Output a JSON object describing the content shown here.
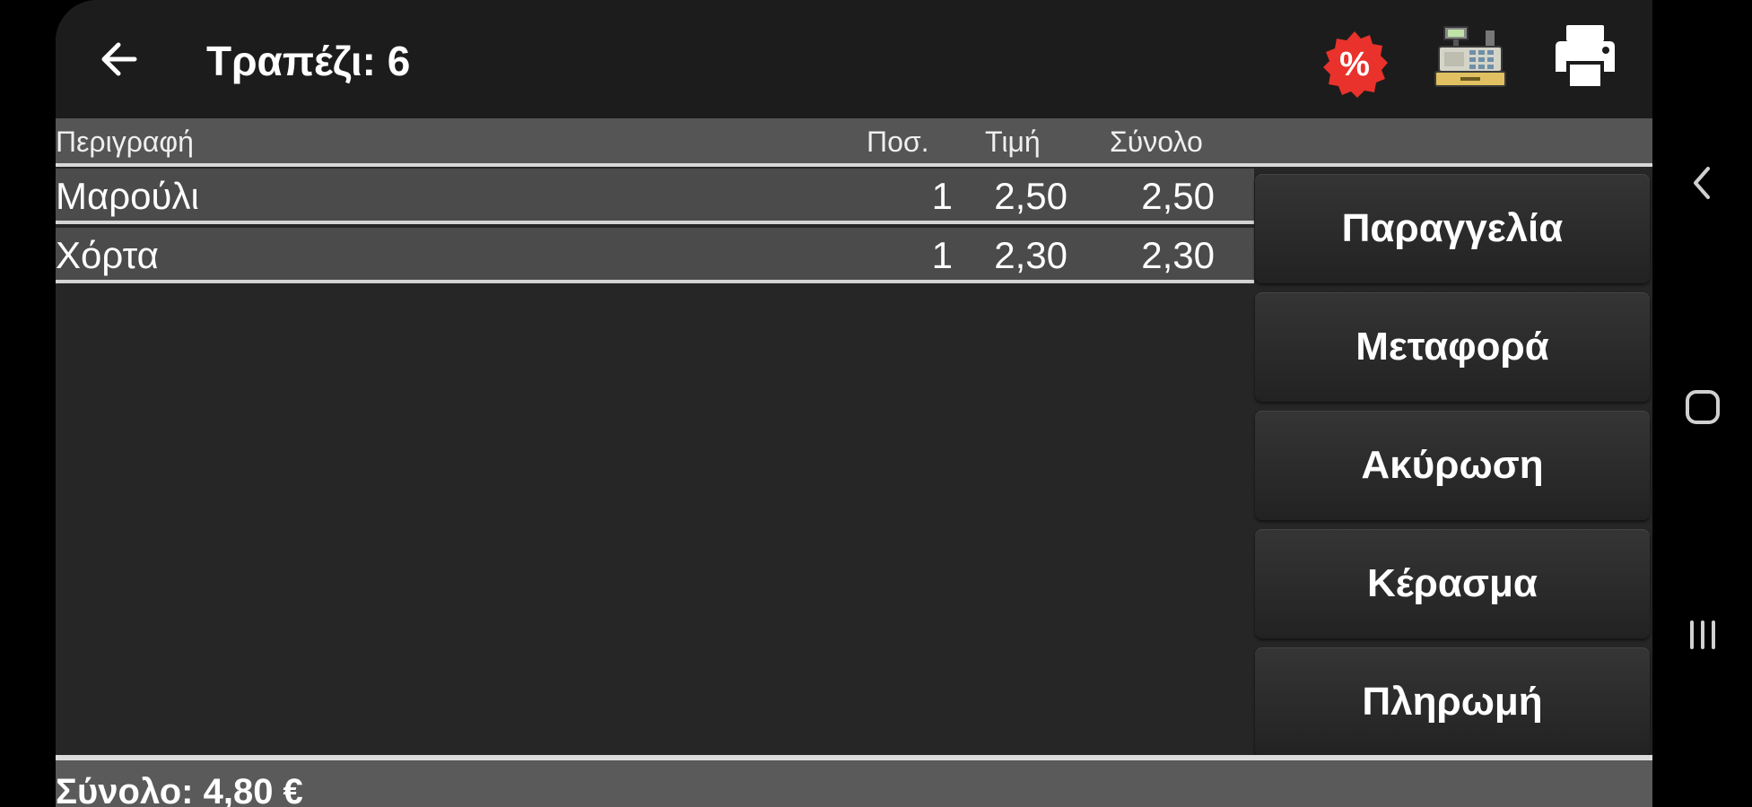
{
  "header": {
    "title": "Τραπέζι: 6",
    "back_icon": "arrow-left-icon",
    "discount_icon": "percent-badge-icon",
    "discount_symbol": "%",
    "register_icon": "cash-register-icon",
    "print_icon": "printer-icon"
  },
  "columns": {
    "description": "Περιγραφή",
    "quantity": "Ποσ.",
    "price": "Τιμή",
    "total": "Σύνολο"
  },
  "items": [
    {
      "description": "Μαρούλι",
      "quantity": "1",
      "price": "2,50",
      "total": "2,50"
    },
    {
      "description": "Χόρτα",
      "quantity": "1",
      "price": "2,30",
      "total": "2,30"
    }
  ],
  "actions": {
    "order": "Παραγγελία",
    "transfer": "Μεταφορά",
    "cancel": "Ακύρωση",
    "treat": "Κέρασμα",
    "payment": "Πληρωμή"
  },
  "footer": {
    "total": "Σύνολο: 4,80 €"
  },
  "system_nav": {
    "back_icon": "chevron-left-icon",
    "home_icon": "home-square-icon",
    "recents_icon": "recents-icon"
  },
  "colors": {
    "discount_badge": "#e8322b",
    "background": "#262626",
    "header": "#1c1c1c"
  }
}
